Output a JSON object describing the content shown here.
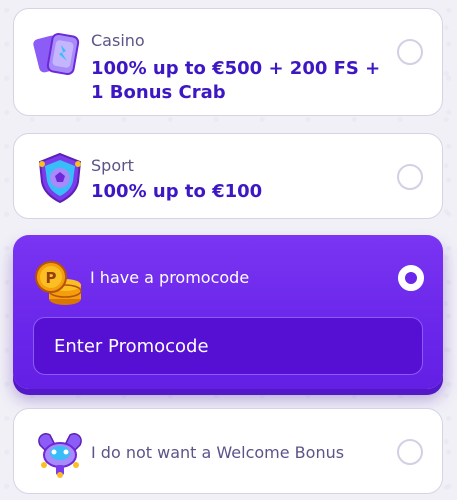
{
  "options": {
    "casino": {
      "label": "Casino",
      "offer_line1": "100% up to €500 + 200 FS +",
      "offer_line2": "1 Bonus Crab",
      "icon": "casino-tickets-icon",
      "selected": false
    },
    "sport": {
      "label": "Sport",
      "offer": "100% up to €100",
      "icon": "sport-shield-icon",
      "selected": false
    },
    "promocode": {
      "label": "I have a promocode",
      "input_placeholder": "Enter Promocode",
      "icon": "gold-coins-icon",
      "selected": true
    },
    "no_bonus": {
      "label": "I do not want a Welcome Bonus",
      "icon": "crab-claw-icon",
      "selected": false
    }
  },
  "colors": {
    "accent": "#6a26ea",
    "offer_text": "#3d17c4",
    "label_text": "#5b5488",
    "background": "#f1f0f7"
  }
}
